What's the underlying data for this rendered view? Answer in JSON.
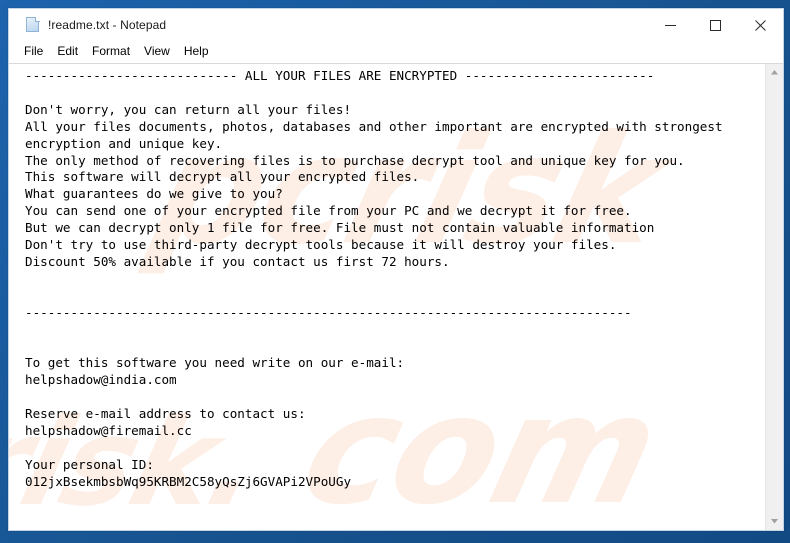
{
  "window": {
    "title": "!readme.txt - Notepad",
    "icon": "notepad-document-icon",
    "controls": {
      "minimize": "Minimize",
      "maximize": "Maximize",
      "close": "Close"
    }
  },
  "menubar": {
    "items": [
      {
        "label": "File"
      },
      {
        "label": "Edit"
      },
      {
        "label": "Format"
      },
      {
        "label": "View"
      },
      {
        "label": "Help"
      }
    ]
  },
  "scrollbar": {
    "up_arrow": "scroll-up",
    "down_arrow": "scroll-down"
  },
  "document": {
    "filename": "!readme.txt",
    "header_separator_left": "----------------------------",
    "header_title": "ALL YOUR FILES ARE ENCRYPTED",
    "header_separator_right": "-------------------------",
    "divider": "--------------------------------------------------------------------------------",
    "body_lines": [
      "Don't worry, you can return all your files!",
      "All your files documents, photos, databases and other important are encrypted with strongest",
      "encryption and unique key.",
      "The only method of recovering files is to purchase decrypt tool and unique key for you.",
      "This software will decrypt all your encrypted files.",
      "What guarantees do we give to you?",
      "You can send one of your encrypted file from your PC and we decrypt it for free.",
      "But we can decrypt only 1 file for free. File must not contain valuable information",
      "Don't try to use third-party decrypt tools because it will destroy your files.",
      "Discount 50% available if you contact us first 72 hours."
    ],
    "contact_primary_label": "To get this software you need write on our e-mail:",
    "contact_primary_email": "helpshadow@india.com",
    "contact_reserve_label": "Reserve e-mail address to contact us:",
    "contact_reserve_email": "helpshadow@firemail.cc",
    "personal_id_label": "Your personal ID:",
    "personal_id_value": "012jxBsekmbsbWq95KRBM2C58yQsZj6GVAPi2VPoUGy",
    "full_text": "---------------------------- ALL YOUR FILES ARE ENCRYPTED -------------------------\n\nDon't worry, you can return all your files!\nAll your files documents, photos, databases and other important are encrypted with strongest\nencryption and unique key.\nThe only method of recovering files is to purchase decrypt tool and unique key for you.\nThis software will decrypt all your encrypted files.\nWhat guarantees do we give to you?\nYou can send one of your encrypted file from your PC and we decrypt it for free.\nBut we can decrypt only 1 file for free. File must not contain valuable information\nDon't try to use third-party decrypt tools because it will destroy your files.\nDiscount 50% available if you contact us first 72 hours.\n\n\n--------------------------------------------------------------------------------\n\n\nTo get this software you need write on our e-mail:\nhelpshadow@india.com\n\nReserve e-mail address to contact us:\nhelpshadow@firemail.cc\n\nYour personal ID:\n012jxBsekmbsbWq95KRBM2C58yQsZj6GVAPi2VPoUGy"
  },
  "watermark": {
    "line1": "pcrisk",
    "line2": "com",
    "line3": "risk."
  },
  "colors": {
    "desktop_blue": "#17538f",
    "window_bg": "#ffffff",
    "text": "#000000",
    "scrollbar_track": "#f0f0f0",
    "watermark_peach": "#fdefe7"
  }
}
